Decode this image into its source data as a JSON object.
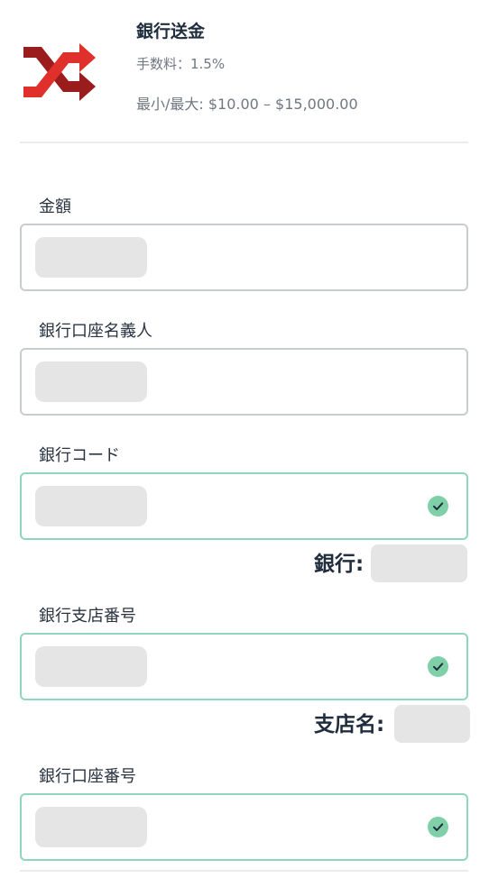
{
  "payment_method": {
    "title": "銀行送金",
    "fee": "手数料：1.5%",
    "limits": "最小/最大: $10.00 – $15,000.00",
    "logo_icon": "shuffle-arrows-icon",
    "logo_colors": [
      "#e0302b",
      "#9a1c1c"
    ]
  },
  "form": {
    "amount": {
      "label": "金額",
      "value_state": "redacted",
      "validated": false
    },
    "account_holder": {
      "label": "銀行口座名義人",
      "value_state": "redacted",
      "validated": false
    },
    "bank_code": {
      "label": "銀行コード",
      "value_state": "redacted",
      "validated": true,
      "status_icon": "check-circle-icon",
      "lookup_label": "銀行:",
      "lookup_value_state": "redacted"
    },
    "branch_number": {
      "label": "銀行支店番号",
      "value_state": "redacted",
      "validated": true,
      "status_icon": "check-circle-icon",
      "lookup_label": "支店名:",
      "lookup_value_state": "redacted"
    },
    "account_number": {
      "label": "銀行口座番号",
      "value_state": "redacted",
      "validated": true,
      "status_icon": "check-circle-icon"
    }
  },
  "colors": {
    "valid_border": "#8fd6bd",
    "default_border": "#c9cccf",
    "check_fill": "#7fd0a8"
  }
}
